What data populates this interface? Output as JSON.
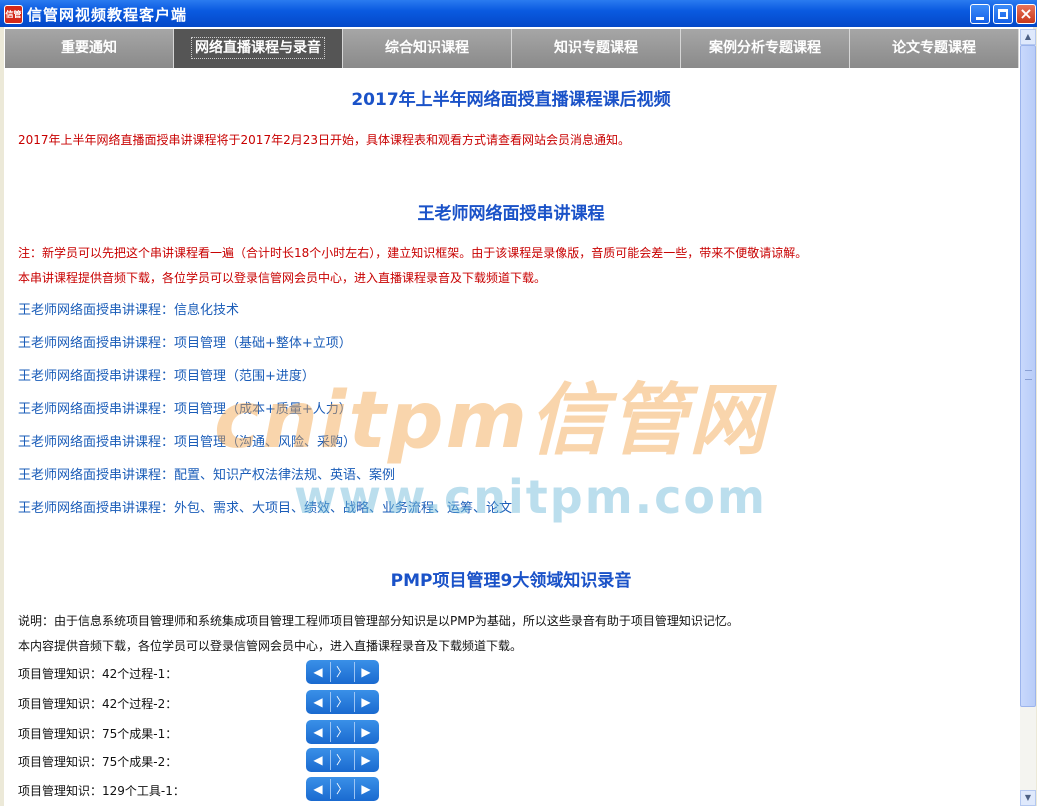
{
  "window": {
    "title": "信管网视频教程客户端",
    "icon_text": "信管"
  },
  "tabs": [
    {
      "label": "重要通知"
    },
    {
      "label": "网络直播课程与录音"
    },
    {
      "label": "综合知识课程"
    },
    {
      "label": "知识专题课程"
    },
    {
      "label": "案例分析专题课程"
    },
    {
      "label": "论文专题课程"
    }
  ],
  "active_tab_index": 1,
  "section1": {
    "title": "2017年上半年网络面授直播课程课后视频",
    "notice": "2017年上半年网络直播面授串讲课程将于2017年2月23日开始，具体课程表和观看方式请查看网站会员消息通知。"
  },
  "section2": {
    "title": "王老师网络面授串讲课程",
    "note1": "注：新学员可以先把这个串讲课程看一遍（合计时长18个小时左右），建立知识框架。由于该课程是录像版，音质可能会差一些，带来不便敬请谅解。",
    "note2": "本串讲课程提供音频下载，各位学员可以登录信管网会员中心，进入直播课程录音及下载频道下载。",
    "links": [
      "王老师网络面授串讲课程：信息化技术",
      "王老师网络面授串讲课程：项目管理（基础+整体+立项）",
      "王老师网络面授串讲课程：项目管理（范围+进度）",
      "王老师网络面授串讲课程：项目管理（成本+质量+人力）",
      "王老师网络面授串讲课程：项目管理（沟通、风险、采购）",
      "王老师网络面授串讲课程：配置、知识产权法律法规、英语、案例",
      "王老师网络面授串讲课程：外包、需求、大项目、绩效、战略、业务流程、运筹、论文"
    ]
  },
  "section3": {
    "title": "PMP项目管理9大领域知识录音",
    "desc1": "说明：由于信息系统项目管理师和系统集成项目管理工程师项目管理部分知识是以PMP为基础，所以这些录音有助于项目管理知识记忆。",
    "desc2": "本内容提供音频下载，各位学员可以登录信管网会员中心，进入直播课程录音及下载频道下载。",
    "audio_items": [
      "项目管理知识：42个过程-1：",
      "项目管理知识：42个过程-2：",
      "项目管理知识：75个成果-1：",
      "项目管理知识：75个成果-2：",
      "项目管理知识：129个工具-1："
    ]
  },
  "player_glyphs": {
    "volume": "◀",
    "next": "〉",
    "play": "▶"
  },
  "watermark": {
    "brand": "cnitpm信管网",
    "url": "www.cnitpm.com"
  },
  "scrollbar": {
    "up": "▲",
    "down": "▼"
  }
}
